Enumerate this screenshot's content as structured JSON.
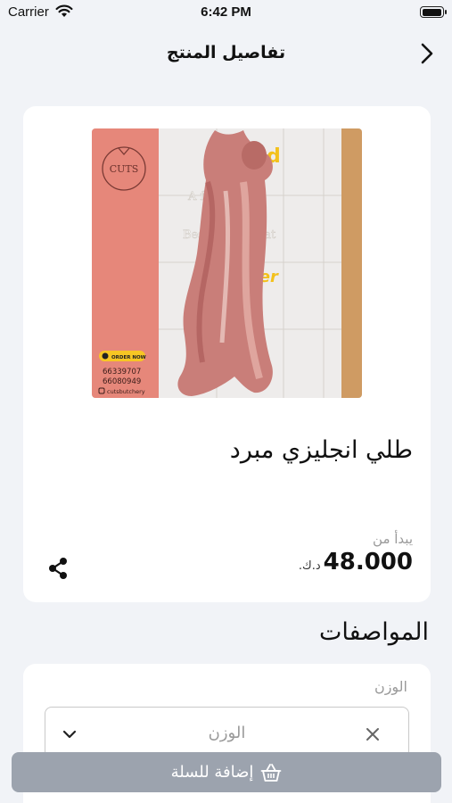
{
  "status_bar": {
    "carrier": "Carrier",
    "time": "6:42 PM"
  },
  "nav": {
    "title": "تفاصيل المنتج"
  },
  "product": {
    "image_texts": {
      "logo": "CUTS",
      "order_badge": "ORDER NOW",
      "phone1": "66339707",
      "phone2": "66080949",
      "handle": "cutsbutchery",
      "wall_line1": "A   fresh meat",
      "wall_line2": "Best   fresh meat"
    },
    "name": "طلي انجليزي مبرد",
    "price_from_label": "يبدأ من",
    "price_value": "48.000",
    "price_currency": "د.ك."
  },
  "specs": {
    "title": "المواصفات",
    "weight_label": "الوزن",
    "weight_placeholder": "الوزن"
  },
  "add_to_cart": {
    "label": "إضافة للسلة"
  }
}
